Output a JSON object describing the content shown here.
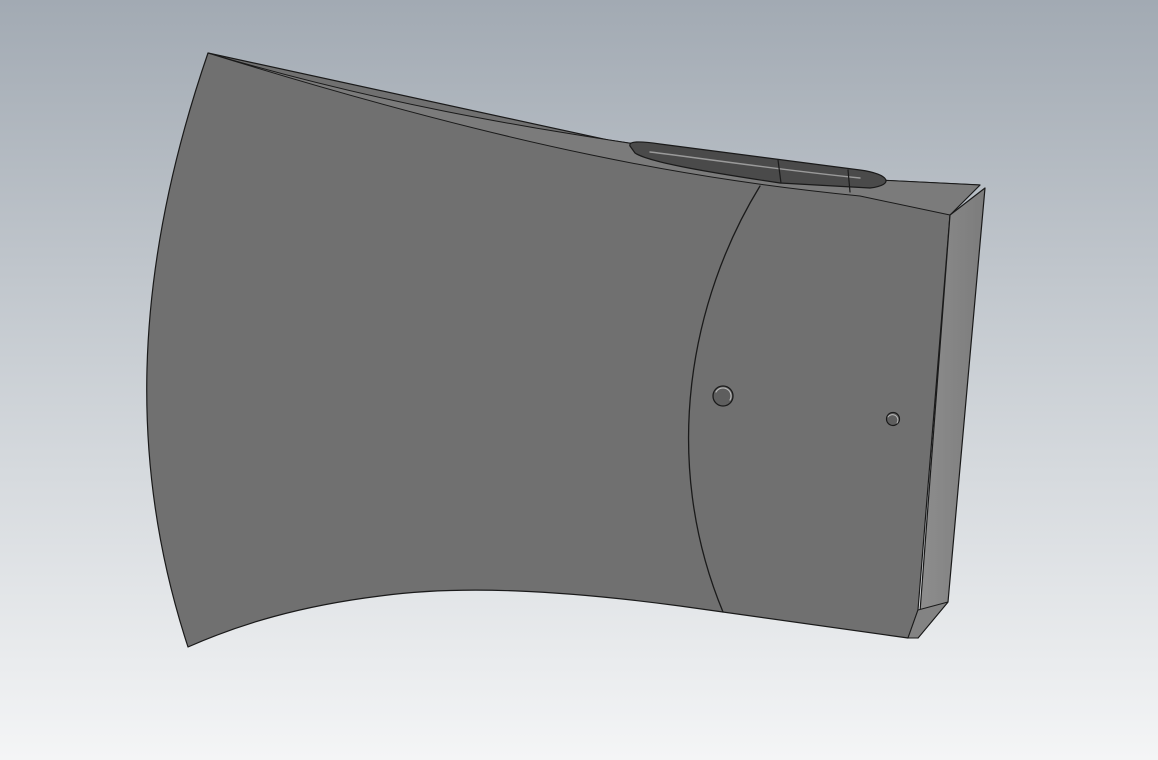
{
  "viewport": {
    "background_top": "#a2aab3",
    "background_bottom": "#f4f5f6",
    "model_face_color": "#707070",
    "model_bevel_color": "#7a7a7a",
    "model_side_color": "#888888",
    "edge_color": "#1a1a1a"
  }
}
